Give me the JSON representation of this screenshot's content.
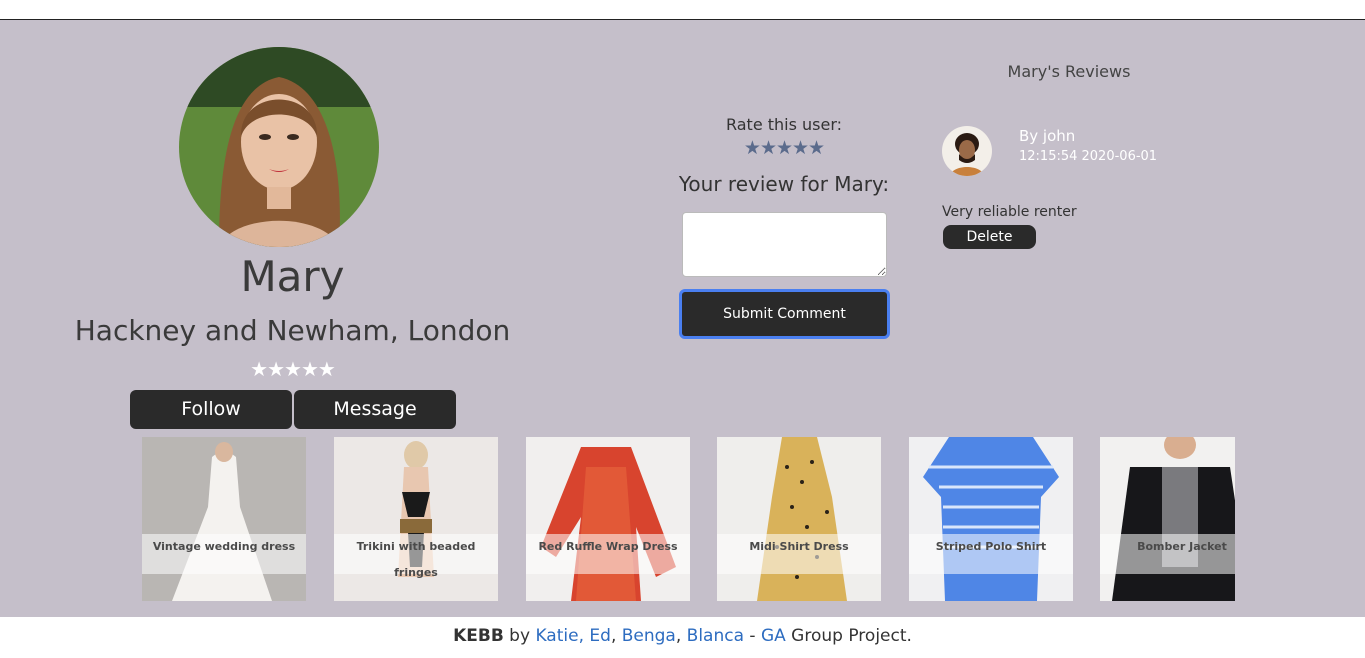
{
  "profile": {
    "name": "Mary",
    "location": "Hackney and Newham, London",
    "stars": "★★★★★",
    "follow_label": "Follow",
    "message_label": "Message"
  },
  "rating": {
    "label": "Rate this user:",
    "stars": "★★★★★",
    "review_title": "Your review for Mary:",
    "review_value": "",
    "submit_label": "Submit Comment"
  },
  "reviews": {
    "title": "Mary's Reviews",
    "items": [
      {
        "author": "By john",
        "timestamp": "12:15:54 2020-06-01",
        "text": "Very reliable renter",
        "delete_label": "Delete"
      }
    ]
  },
  "listings": [
    {
      "title": "Vintage wedding dress"
    },
    {
      "title": "Trikini with beaded fringes"
    },
    {
      "title": "Red Ruffle Wrap Dress"
    },
    {
      "title": "Midi Shirt Dress"
    },
    {
      "title": "Striped Polo Shirt"
    },
    {
      "title": "Bomber Jacket"
    }
  ],
  "footer": {
    "brand": "KEBB",
    "by": " by ",
    "authors": [
      "Katie",
      "Ed",
      "Benga",
      "Blanca"
    ],
    "dash": " - ",
    "org": "GA",
    "suffix": " Group Project."
  },
  "colors": {
    "page_bg": "#c5bfca",
    "button_dark": "#2a2a2a",
    "focus_ring": "#4a7ff0",
    "link": "#2d6cc0",
    "rate_star": "#5b6b8c"
  }
}
